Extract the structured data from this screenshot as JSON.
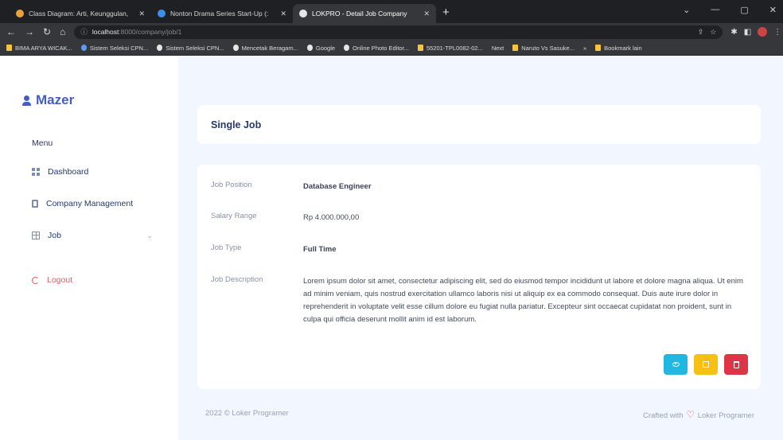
{
  "browser": {
    "tabs": [
      {
        "title": "Class Diagram: Arti, Keunggulan,",
        "favicon_color": "#e8a23b",
        "active": false
      },
      {
        "title": "Nonton Drama Series Start-Up (:",
        "favicon_color": "#3b8fe8",
        "active": false
      },
      {
        "title": "LOKPRO - Detail Job Company",
        "favicon_color": "#e6e6e6",
        "active": true
      }
    ],
    "new_tab": "+",
    "url_host": "localhost",
    "url_path": ":8000/company/job/1",
    "window_controls": [
      "⌄",
      "—",
      "▢",
      "✕"
    ],
    "bookmarks": [
      "BIMA ARYA WICAK...",
      "Sistem Seleksi CPN...",
      "Sistem Seleksi CPN...",
      "Mencetak Beragam...",
      "Google",
      "Online Photo Editor...",
      "55201-TPL0082-02...",
      "Next",
      "Naruto Vs Sasuke...",
      "»",
      "Bookmark lain"
    ]
  },
  "sidebar": {
    "brand": "Mazer",
    "menu_title": "Menu",
    "items": [
      {
        "label": "Dashboard",
        "icon": "grid-icon"
      },
      {
        "label": "Company Management",
        "icon": "building-icon"
      },
      {
        "label": "Job",
        "icon": "table-icon",
        "has_submenu": true
      },
      {
        "label": "Logout",
        "icon": "logout-icon"
      }
    ]
  },
  "page": {
    "title": "Single Job"
  },
  "job": {
    "position_label": "Job Position",
    "position_value": "Database Engineer",
    "salary_label": "Salary Range",
    "salary_value": "Rp 4.000.000,00",
    "type_label": "Job Type",
    "type_value": "Full Time",
    "description_label": "Job Description",
    "description_value": "Lorem ipsum dolor sit amet, consectetur adipiscing elit, sed do eiusmod tempor incididunt ut labore et dolore magna aliqua. Ut enim ad minim veniam, quis nostrud exercitation ullamco laboris nisi ut aliquip ex ea commodo consequat. Duis aute irure dolor in reprehenderit in voluptate velit esse cillum dolore eu fugiat nulla pariatur. Excepteur sint occaecat cupidatat non proident, sunt in culpa qui officia deserunt mollit anim id est laborum."
  },
  "actions": {
    "view_color": "#20b8e0",
    "edit_color": "#f7c014",
    "delete_color": "#dc3545"
  },
  "footer": {
    "left": "2022 © Loker Programer",
    "right_prefix": "Crafted with",
    "right_suffix": "Loker Programer"
  }
}
